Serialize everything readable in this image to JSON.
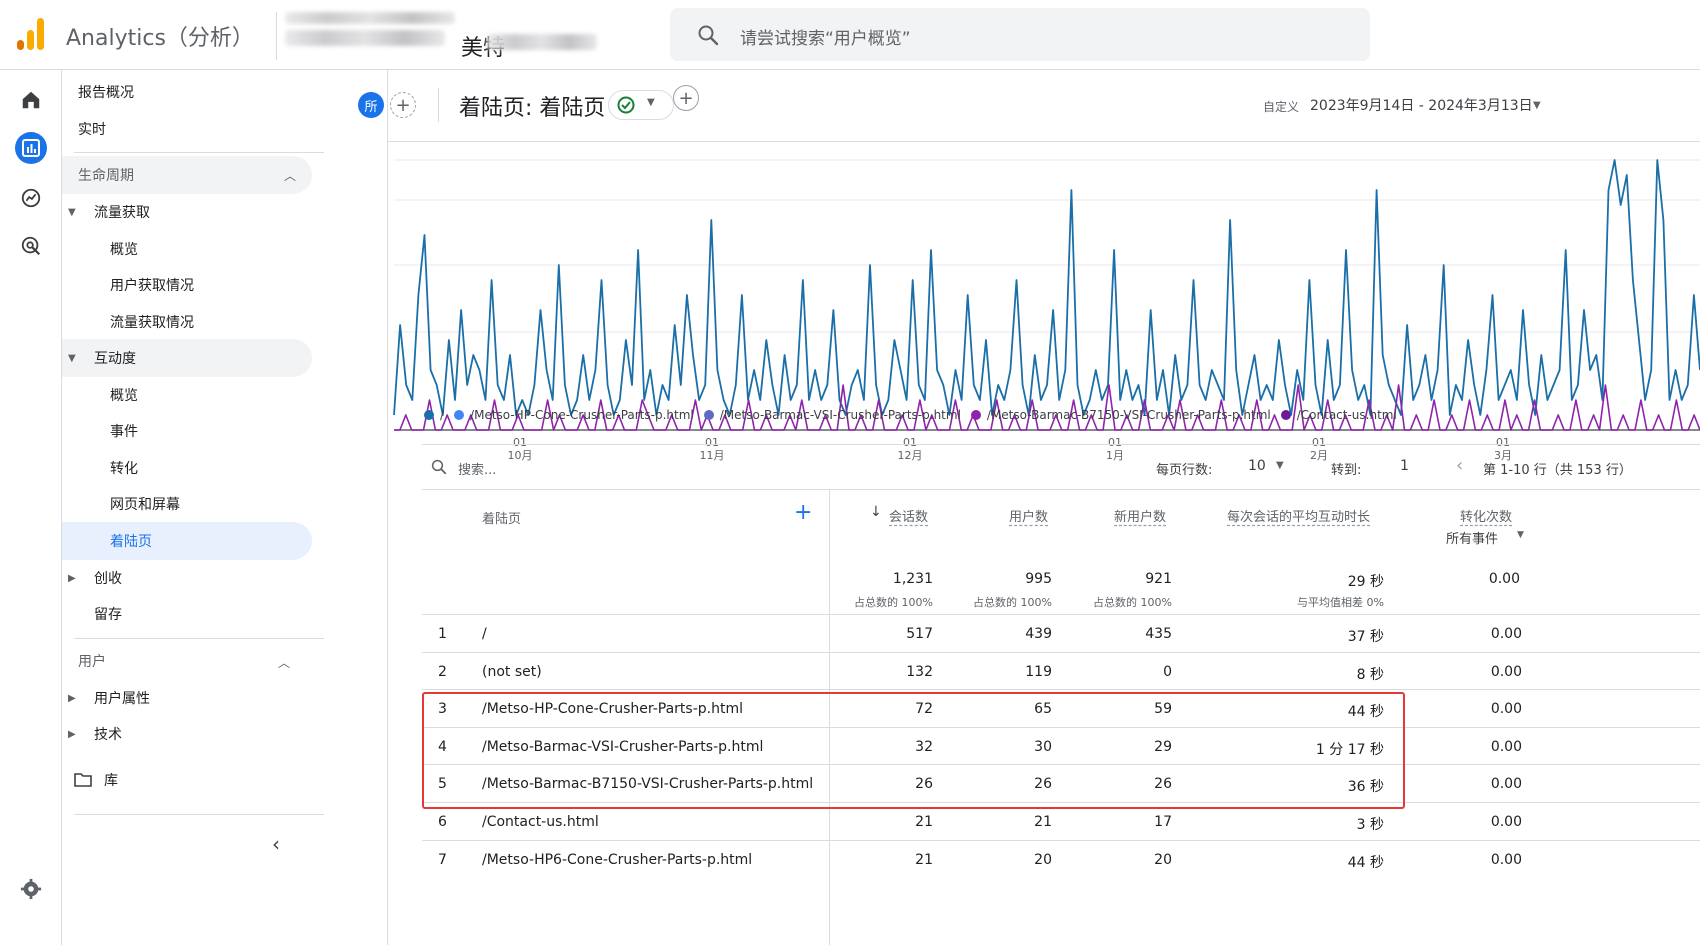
{
  "app": {
    "title": "Analytics（分析）",
    "account_name": "美特"
  },
  "search": {
    "placeholder": "请尝试搜索“用户概览”"
  },
  "nav": {
    "items": [
      {
        "label": "报告概况"
      },
      {
        "label": "实时"
      },
      {
        "label": "生命周期"
      },
      {
        "label": "流量获取"
      },
      {
        "label": "概览"
      },
      {
        "label": "用户获取情况"
      },
      {
        "label": "流量获取情况"
      },
      {
        "label": "互动度"
      },
      {
        "label": "概览"
      },
      {
        "label": "事件"
      },
      {
        "label": "转化"
      },
      {
        "label": "网页和屏幕"
      },
      {
        "label": "着陆页"
      },
      {
        "label": "创收"
      },
      {
        "label": "留存"
      },
      {
        "label": "用户"
      },
      {
        "label": "用户属性"
      },
      {
        "label": "技术"
      },
      {
        "label": "库"
      }
    ]
  },
  "report": {
    "segment_badge": "所",
    "title": "着陆页: 着陆页",
    "date_label": "自定义",
    "date_range": "2023年9月14日 - 2024年3月13日"
  },
  "chart_data": {
    "type": "line",
    "x_ticks": [
      {
        "day": "01",
        "month": "10月"
      },
      {
        "day": "01",
        "month": "11月"
      },
      {
        "day": "01",
        "month": "12月"
      },
      {
        "day": "01",
        "month": "1月"
      },
      {
        "day": "01",
        "month": "2月"
      },
      {
        "day": "01",
        "month": "3月"
      }
    ],
    "legend": [
      "/",
      "/Metso-HP-Cone-Crusher-Parts-p.html",
      "/Metso-Barmac-VSI-Crusher-Parts-p.html",
      "/Metso-Barmac-B7150-VSI-Crusher-Parts-p.html",
      "/Contact-us.html"
    ],
    "series": [
      {
        "name": "/",
        "color": "#1a6fa8",
        "values": [
          1,
          7,
          3,
          2,
          9,
          13,
          4,
          3,
          1,
          6,
          2,
          8,
          3,
          5,
          4,
          2,
          10,
          3,
          2,
          5,
          1,
          2,
          1,
          3,
          8,
          4,
          2,
          11,
          3,
          1,
          2,
          5,
          2,
          4,
          10,
          3,
          1,
          2,
          6,
          3,
          12,
          2,
          4,
          1,
          3,
          2,
          7,
          3,
          9,
          5,
          2,
          3,
          14,
          4,
          2,
          1,
          3,
          9,
          2,
          4,
          2,
          6,
          3,
          1,
          5,
          2,
          3,
          10,
          2,
          4,
          2,
          3,
          8,
          2,
          1,
          3,
          4,
          2,
          11,
          3,
          1,
          2,
          6,
          4,
          2,
          10,
          3,
          2,
          12,
          4,
          3,
          1,
          4,
          2,
          9,
          3,
          2,
          6,
          1,
          3,
          2,
          4,
          10,
          3,
          1,
          5,
          2,
          3,
          8,
          2,
          4,
          16,
          3,
          1,
          2,
          4,
          2,
          3,
          12,
          2,
          4,
          2,
          3,
          1,
          8,
          2,
          4,
          1,
          5,
          2,
          3,
          10,
          3,
          2,
          4,
          3,
          2,
          14,
          4,
          1,
          3,
          5,
          2,
          3,
          2,
          6,
          3,
          1,
          4,
          2,
          10,
          3,
          1,
          6,
          2,
          3,
          12,
          4,
          2,
          3,
          1,
          16,
          5,
          3,
          2,
          1,
          7,
          2,
          3,
          5,
          2,
          4,
          11,
          1,
          3,
          2,
          6,
          3,
          1,
          4,
          9,
          2,
          3,
          4,
          2,
          8,
          3,
          1,
          5,
          2,
          3,
          4,
          12,
          2,
          3,
          8,
          4,
          5,
          2,
          16,
          18,
          15,
          17,
          10,
          6,
          2,
          4,
          18,
          14,
          2,
          4,
          2,
          3,
          9,
          4
        ],
        "_note": ""
      },
      {
        "name": "/Metso-HP-Cone-Crusher-Parts-p.html",
        "color": "#4285f4",
        "values": []
      },
      {
        "name": "/Metso-Barmac-VSI-Crusher-Parts-p.html",
        "color": "#5c6bc0",
        "values": []
      },
      {
        "name": "/Metso-Barmac-B7150-VSI-Crusher-Parts-p.html",
        "color": "#8e24aa",
        "values": [
          0,
          0,
          1,
          0,
          0,
          0,
          2,
          0,
          0,
          1,
          0,
          0,
          0,
          1,
          0,
          0,
          0,
          2,
          0,
          0,
          0,
          1,
          0,
          0,
          0,
          0,
          2,
          0,
          1,
          0,
          0,
          0,
          1,
          0,
          0,
          2,
          0,
          0,
          1,
          0,
          0,
          0,
          2,
          1,
          0,
          0,
          0,
          1,
          0,
          0,
          0,
          2,
          0,
          1,
          0,
          0,
          1,
          0,
          0,
          0,
          2,
          0,
          0,
          1,
          0,
          0,
          0,
          1,
          0,
          2,
          0,
          0,
          0,
          1,
          0,
          0,
          3,
          0,
          0,
          1,
          0,
          0,
          2,
          0,
          0,
          0,
          1,
          0,
          0,
          2,
          0,
          1,
          0,
          0,
          0,
          2,
          0,
          0,
          1,
          0,
          0,
          0,
          2,
          0,
          0,
          1,
          0,
          0,
          2,
          0,
          0,
          0,
          1,
          0,
          0,
          2,
          0,
          0,
          1,
          0,
          0,
          3,
          0,
          0,
          1,
          0,
          0,
          2,
          0,
          0,
          0,
          1,
          0,
          2,
          0,
          0,
          1,
          0,
          0,
          0,
          2,
          0,
          0,
          1,
          0,
          0,
          2,
          0,
          0,
          1,
          0,
          0,
          0,
          3,
          0,
          1,
          0,
          0,
          2,
          0,
          0,
          1,
          0,
          0,
          0,
          2,
          0,
          0,
          1,
          0,
          3,
          0,
          0,
          1,
          0,
          0,
          2,
          0,
          0,
          1,
          0,
          0,
          2,
          0,
          0,
          1,
          0,
          0,
          2,
          0,
          1,
          0,
          0,
          2,
          0,
          0,
          0,
          1,
          0,
          0,
          2,
          0,
          0,
          1,
          0,
          3,
          0,
          0,
          1,
          0,
          0,
          2,
          0,
          0,
          1,
          0,
          0,
          2,
          0,
          0,
          1,
          0
        ]
      },
      {
        "name": "/Contact-us.html",
        "color": "#6a1b9a",
        "values": []
      }
    ]
  },
  "table": {
    "search_placeholder": "搜索...",
    "rows_per_page_label": "每页行数:",
    "rows_per_page": "10",
    "goto_label": "转到:",
    "goto_value": "1",
    "page_info": "第 1-10 行（共 153 行）",
    "columns": {
      "dimension": "着陆页",
      "sessions": "会话数",
      "users": "用户数",
      "new_users": "新用户数",
      "avg_engagement": "每次会话的平均互动时长",
      "conversions": "转化次数",
      "conversions_sub": "所有事件"
    },
    "totals": {
      "sessions": "1,231",
      "sessions_sub": "占总数的 100%",
      "users": "995",
      "users_sub": "占总数的 100%",
      "new_users": "921",
      "new_users_sub": "占总数的 100%",
      "avg_engagement": "29 秒",
      "avg_engagement_sub": "与平均值相差 0%",
      "conversions": "0.00"
    },
    "rows": [
      {
        "idx": "1",
        "page": "/",
        "sessions": "517",
        "users": "439",
        "new_users": "435",
        "avg": "37 秒",
        "conv": "0.00"
      },
      {
        "idx": "2",
        "page": "(not set)",
        "sessions": "132",
        "users": "119",
        "new_users": "0",
        "avg": "8 秒",
        "conv": "0.00"
      },
      {
        "idx": "3",
        "page": "/Metso-HP-Cone-Crusher-Parts-p.html",
        "sessions": "72",
        "users": "65",
        "new_users": "59",
        "avg": "44 秒",
        "conv": "0.00"
      },
      {
        "idx": "4",
        "page": "/Metso-Barmac-VSI-Crusher-Parts-p.html",
        "sessions": "32",
        "users": "30",
        "new_users": "29",
        "avg": "1 分 17 秒",
        "conv": "0.00"
      },
      {
        "idx": "5",
        "page": "/Metso-Barmac-B7150-VSI-Crusher-Parts-p.html",
        "sessions": "26",
        "users": "26",
        "new_users": "26",
        "avg": "36 秒",
        "conv": "0.00"
      },
      {
        "idx": "6",
        "page": "/Contact-us.html",
        "sessions": "21",
        "users": "21",
        "new_users": "17",
        "avg": "3 秒",
        "conv": "0.00"
      },
      {
        "idx": "7",
        "page": "/Metso-HP6-Cone-Crusher-Parts-p.html",
        "sessions": "21",
        "users": "20",
        "new_users": "20",
        "avg": "44 秒",
        "conv": "0.00"
      }
    ]
  }
}
